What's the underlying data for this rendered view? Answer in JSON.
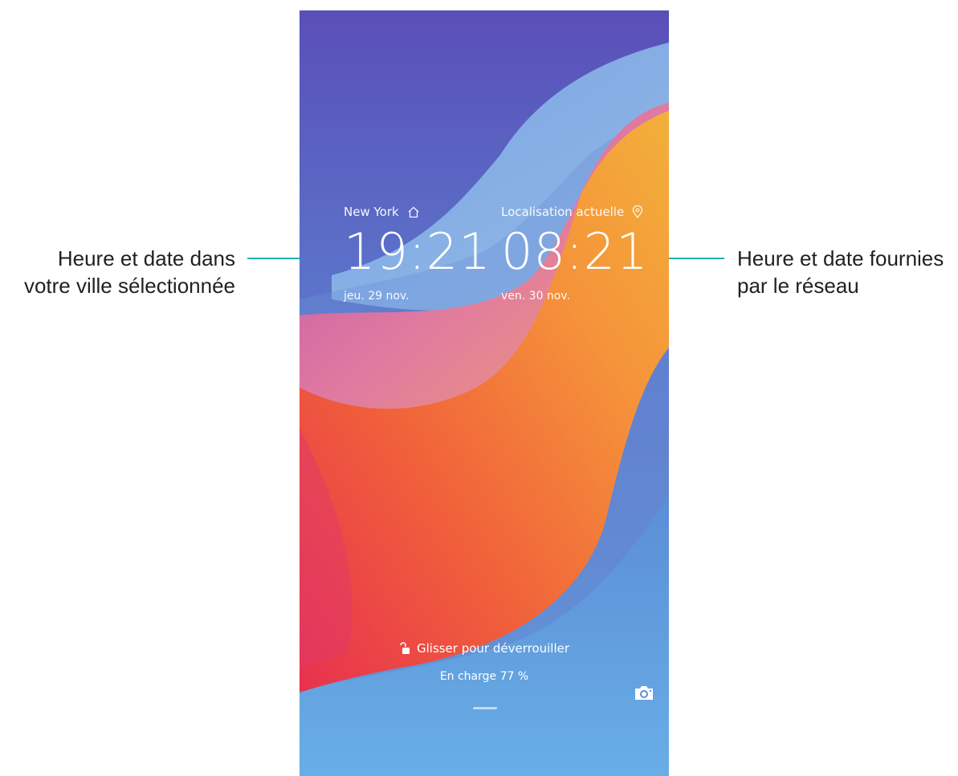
{
  "callouts": {
    "left_line1": "Heure et date dans",
    "left_line2": "votre ville sélectionnée",
    "right_line1": "Heure et date fournies",
    "right_line2": "par le réseau"
  },
  "lockscreen": {
    "home_clock": {
      "city": "New York",
      "icon": "home-icon",
      "time": "19:21",
      "date": "jeu. 29 nov."
    },
    "local_clock": {
      "city": "Localisation actuelle",
      "icon": "location-pin-icon",
      "time": "08:21",
      "date": "ven. 30 nov."
    },
    "unlock_label": "Glisser pour déverrouiller",
    "unlock_icon": "unlock-icon",
    "charging_label": "En charge 77 %",
    "camera_icon": "camera-icon"
  },
  "colors": {
    "callout_line": "#1fb5b0",
    "background_blue": "#5a6fc6",
    "wave_orange": "#f28a3a",
    "wave_pink": "#e0457a",
    "wave_light_blue": "#7fb0e2"
  }
}
